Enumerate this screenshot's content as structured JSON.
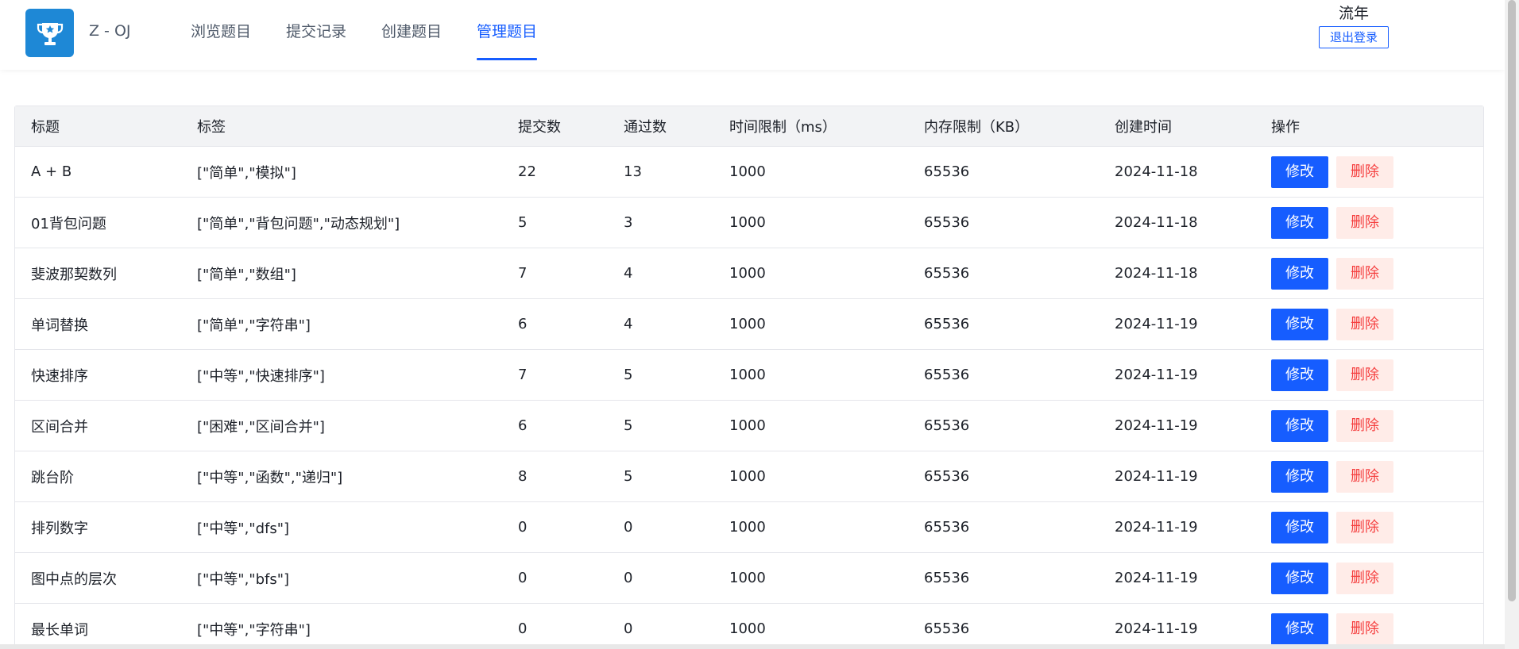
{
  "header": {
    "brand": "Z - OJ",
    "nav": [
      {
        "label": "浏览题目",
        "active": false
      },
      {
        "label": "提交记录",
        "active": false
      },
      {
        "label": "创建题目",
        "active": false
      },
      {
        "label": "管理题目",
        "active": true
      }
    ],
    "user_name": "流年",
    "logout_label": "退出登录"
  },
  "table": {
    "columns": [
      "标题",
      "标签",
      "提交数",
      "通过数",
      "时间限制（ms）",
      "内存限制（KB）",
      "创建时间",
      "操作"
    ],
    "edit_label": "修改",
    "delete_label": "删除",
    "rows": [
      {
        "title": "A + B",
        "tags": "[\"简单\",\"模拟\"]",
        "submits": "22",
        "accepted": "13",
        "time_limit": "1000",
        "memory_limit": "65536",
        "created": "2024-11-18"
      },
      {
        "title": "01背包问题",
        "tags": "[\"简单\",\"背包问题\",\"动态规划\"]",
        "submits": "5",
        "accepted": "3",
        "time_limit": "1000",
        "memory_limit": "65536",
        "created": "2024-11-18"
      },
      {
        "title": "斐波那契数列",
        "tags": "[\"简单\",\"数组\"]",
        "submits": "7",
        "accepted": "4",
        "time_limit": "1000",
        "memory_limit": "65536",
        "created": "2024-11-18"
      },
      {
        "title": "单词替换",
        "tags": "[\"简单\",\"字符串\"]",
        "submits": "6",
        "accepted": "4",
        "time_limit": "1000",
        "memory_limit": "65536",
        "created": "2024-11-19"
      },
      {
        "title": "快速排序",
        "tags": "[\"中等\",\"快速排序\"]",
        "submits": "7",
        "accepted": "5",
        "time_limit": "1000",
        "memory_limit": "65536",
        "created": "2024-11-19"
      },
      {
        "title": "区间合并",
        "tags": "[\"困难\",\"区间合并\"]",
        "submits": "6",
        "accepted": "5",
        "time_limit": "1000",
        "memory_limit": "65536",
        "created": "2024-11-19"
      },
      {
        "title": "跳台阶",
        "tags": "[\"中等\",\"函数\",\"递归\"]",
        "submits": "8",
        "accepted": "5",
        "time_limit": "1000",
        "memory_limit": "65536",
        "created": "2024-11-19"
      },
      {
        "title": "排列数字",
        "tags": "[\"中等\",\"dfs\"]",
        "submits": "0",
        "accepted": "0",
        "time_limit": "1000",
        "memory_limit": "65536",
        "created": "2024-11-19"
      },
      {
        "title": "图中点的层次",
        "tags": "[\"中等\",\"bfs\"]",
        "submits": "0",
        "accepted": "0",
        "time_limit": "1000",
        "memory_limit": "65536",
        "created": "2024-11-19"
      },
      {
        "title": "最长单词",
        "tags": "[\"中等\",\"字符串\"]",
        "submits": "0",
        "accepted": "0",
        "time_limit": "1000",
        "memory_limit": "65536",
        "created": "2024-11-19"
      }
    ]
  },
  "colors": {
    "accent": "#165dff",
    "logo_bg": "#1e88d6",
    "delete_bg": "#ffece8",
    "delete_text": "#f53f3f",
    "header_row_bg": "#f2f3f5"
  },
  "icons": {
    "logo": "trophy-icon"
  }
}
